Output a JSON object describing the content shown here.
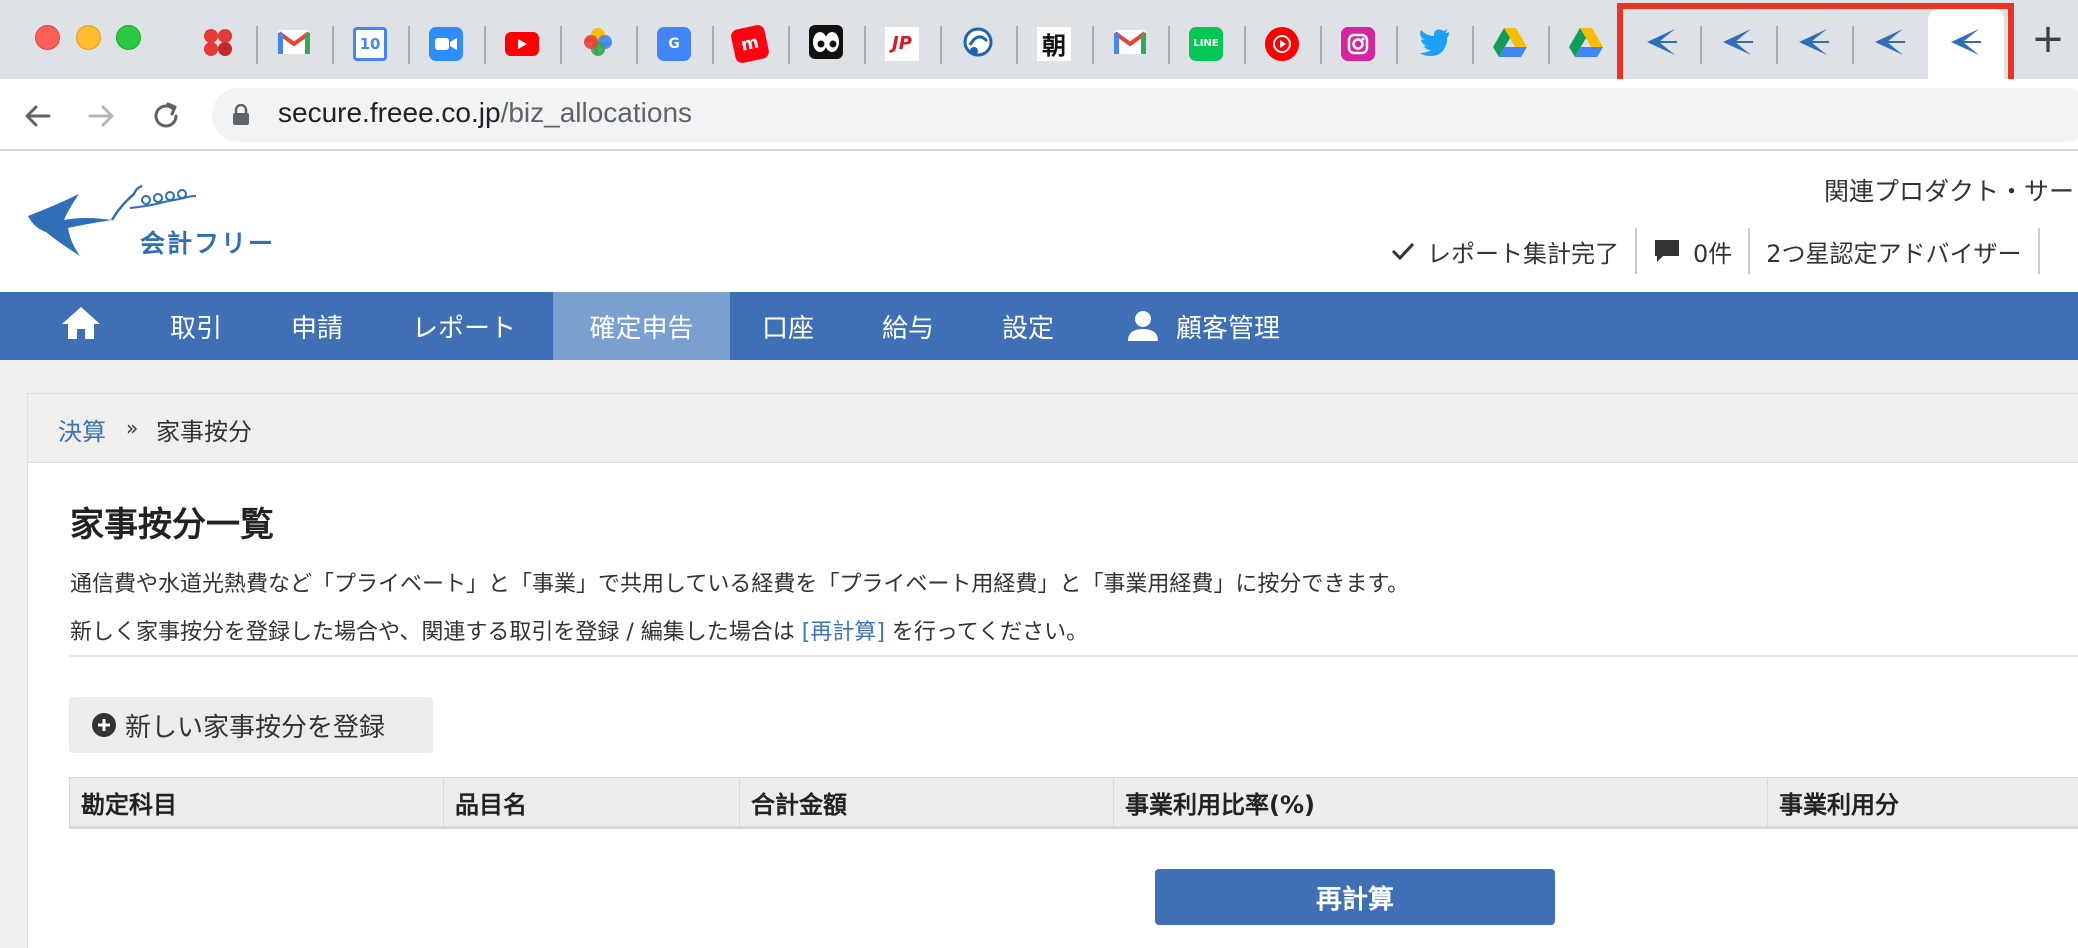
{
  "browser": {
    "pinned_tabs": [
      {
        "name": "ibm-icon"
      },
      {
        "name": "gmail-icon"
      },
      {
        "name": "calendar-icon",
        "text": "10"
      },
      {
        "name": "zoom-icon"
      },
      {
        "name": "youtube-icon"
      },
      {
        "name": "google-photos-icon"
      },
      {
        "name": "google-business-icon",
        "text": "G"
      },
      {
        "name": "mercari-icon",
        "text": "m"
      },
      {
        "name": "eyes-icon"
      },
      {
        "name": "japan-post-icon",
        "text": "JP"
      },
      {
        "name": "yellowbook-icon"
      },
      {
        "name": "asahi-icon",
        "text": "朝"
      },
      {
        "name": "gmail-icon"
      },
      {
        "name": "line-icon",
        "text": "LINE"
      },
      {
        "name": "youtube-music-icon"
      },
      {
        "name": "instagram-icon"
      },
      {
        "name": "twitter-icon"
      },
      {
        "name": "google-drive-icon"
      },
      {
        "name": "google-drive-icon"
      },
      {
        "name": "freee-icon"
      },
      {
        "name": "freee-icon"
      },
      {
        "name": "freee-icon"
      },
      {
        "name": "freee-icon"
      },
      {
        "name": "freee-icon"
      }
    ],
    "url_host": "secure.freee.co.jp",
    "url_path": "/biz_allocations"
  },
  "header": {
    "logo_text": "会計フリー",
    "related_products": "関連プロダクト・サー",
    "report_status": "レポート集計完了",
    "notification_count": "0件",
    "advisor_badge": "2つ星認定アドバイザー"
  },
  "nav": {
    "items": [
      "取引",
      "申請",
      "レポート",
      "確定申告",
      "口座",
      "給与",
      "設定"
    ],
    "active": "確定申告",
    "customer": "顧客管理"
  },
  "breadcrumb": {
    "parent": "決算",
    "separator": "»",
    "current": "家事按分"
  },
  "page": {
    "title": "家事按分一覧",
    "desc1": "通信費や水道光熱費など「プライベート」と「事業」で共用している経費を「プライベート用経費」と「事業用経費」に按分できます。",
    "desc2_before": "新しく家事按分を登録した場合や、関連する取引を登録 / 編集した場合は ",
    "desc2_link": "[再計算]",
    "desc2_after": " を行ってください。",
    "add_button": "新しい家事按分を登録",
    "table_headers": [
      "勘定科目",
      "品目名",
      "合計金額",
      "事業利用比率(%)",
      "事業利用分"
    ],
    "recalc_button": "再計算"
  },
  "colors": {
    "brand_blue": "#3f6fb5",
    "nav_active": "#7aa0cf",
    "link_blue": "#3d74b8",
    "highlight_red": "#ea3323"
  }
}
